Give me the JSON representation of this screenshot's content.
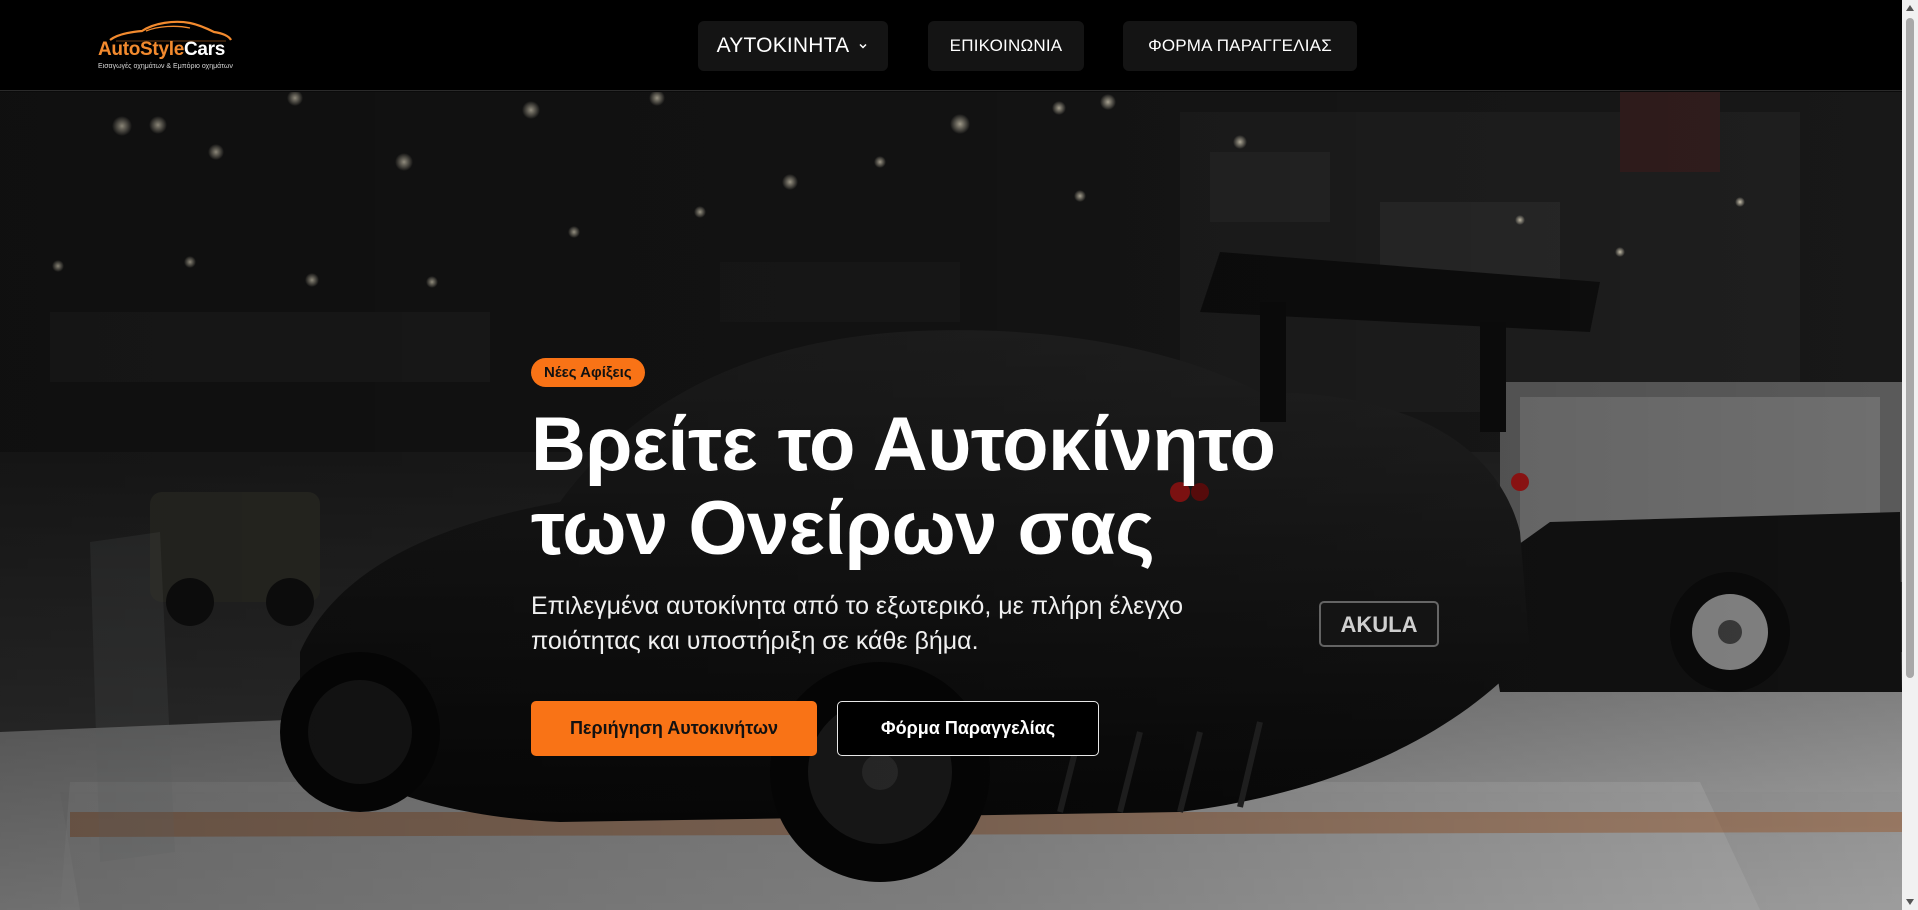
{
  "brand": {
    "name_part1": "AutoStyle",
    "name_part2": "Cars",
    "tagline": "Εισαγωγές οχημάτων & Εμπόριο οχημάτων",
    "accent_color": "#f28a2e"
  },
  "nav": {
    "cars_label": "ΑΥΤΟΚΙΝΗΤΑ",
    "cars_icon": "chevron-down-icon",
    "contact_label": "ΕΠΙΚΟΙΝΩΝΙΑ",
    "order_label": "ΦΟΡΜΑ ΠΑΡΑΓΓΕΛΙΑΣ"
  },
  "hero": {
    "badge": "Νέες Αφίξεις",
    "headline_line1": "Βρείτε το Αυτοκίνητο",
    "headline_line2": "των Ονείρων σας",
    "subtitle_line1": "Επιλεγμένα αυτοκίνητα από το εξωτερικό, με πλήρη έλεγχο",
    "subtitle_line2": "ποιότητας και υποστήριξη σε κάθε βήμα.",
    "primary_button": "Περιήγηση Αυτοκινήτων",
    "secondary_button": "Φόρμα Παραγγελίας",
    "primary_color": "#f97316",
    "plate_text": "AKULA"
  }
}
